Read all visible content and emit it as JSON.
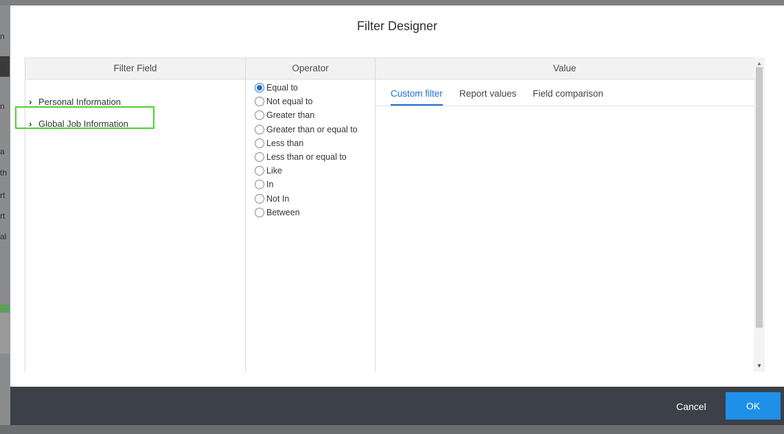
{
  "dialog": {
    "title": "Filter Designer"
  },
  "columns": {
    "field_header": "Filter Field",
    "operator_header": "Operator",
    "value_header": "Value"
  },
  "filter_fields": [
    {
      "label": "Personal Information",
      "icon": "chevron-right-icon",
      "expanded": false
    },
    {
      "label": "Global Job Information",
      "icon": "chevron-right-icon",
      "expanded": false,
      "highlighted": true
    }
  ],
  "operators": [
    {
      "label": "Equal to",
      "selected": true
    },
    {
      "label": "Not equal to",
      "selected": false
    },
    {
      "label": "Greater than",
      "selected": false
    },
    {
      "label": "Greater than or equal to",
      "selected": false
    },
    {
      "label": "Less than",
      "selected": false
    },
    {
      "label": "Less than or equal to",
      "selected": false
    },
    {
      "label": "Like",
      "selected": false
    },
    {
      "label": "In",
      "selected": false
    },
    {
      "label": "Not In",
      "selected": false
    },
    {
      "label": "Between",
      "selected": false
    }
  ],
  "value_tabs": [
    {
      "label": "Custom filter",
      "active": true
    },
    {
      "label": "Report values",
      "active": false
    },
    {
      "label": "Field comparison",
      "active": false
    }
  ],
  "footer": {
    "cancel_label": "Cancel",
    "ok_label": "OK"
  },
  "colors": {
    "accent": "#1a6ed6",
    "ok_button": "#1e90e8",
    "footer_bg": "#3c4049",
    "highlight_border": "#4cd130"
  },
  "background_fragments": [
    "n",
    "n",
    "a",
    "th",
    "rt",
    "rt",
    "al"
  ]
}
